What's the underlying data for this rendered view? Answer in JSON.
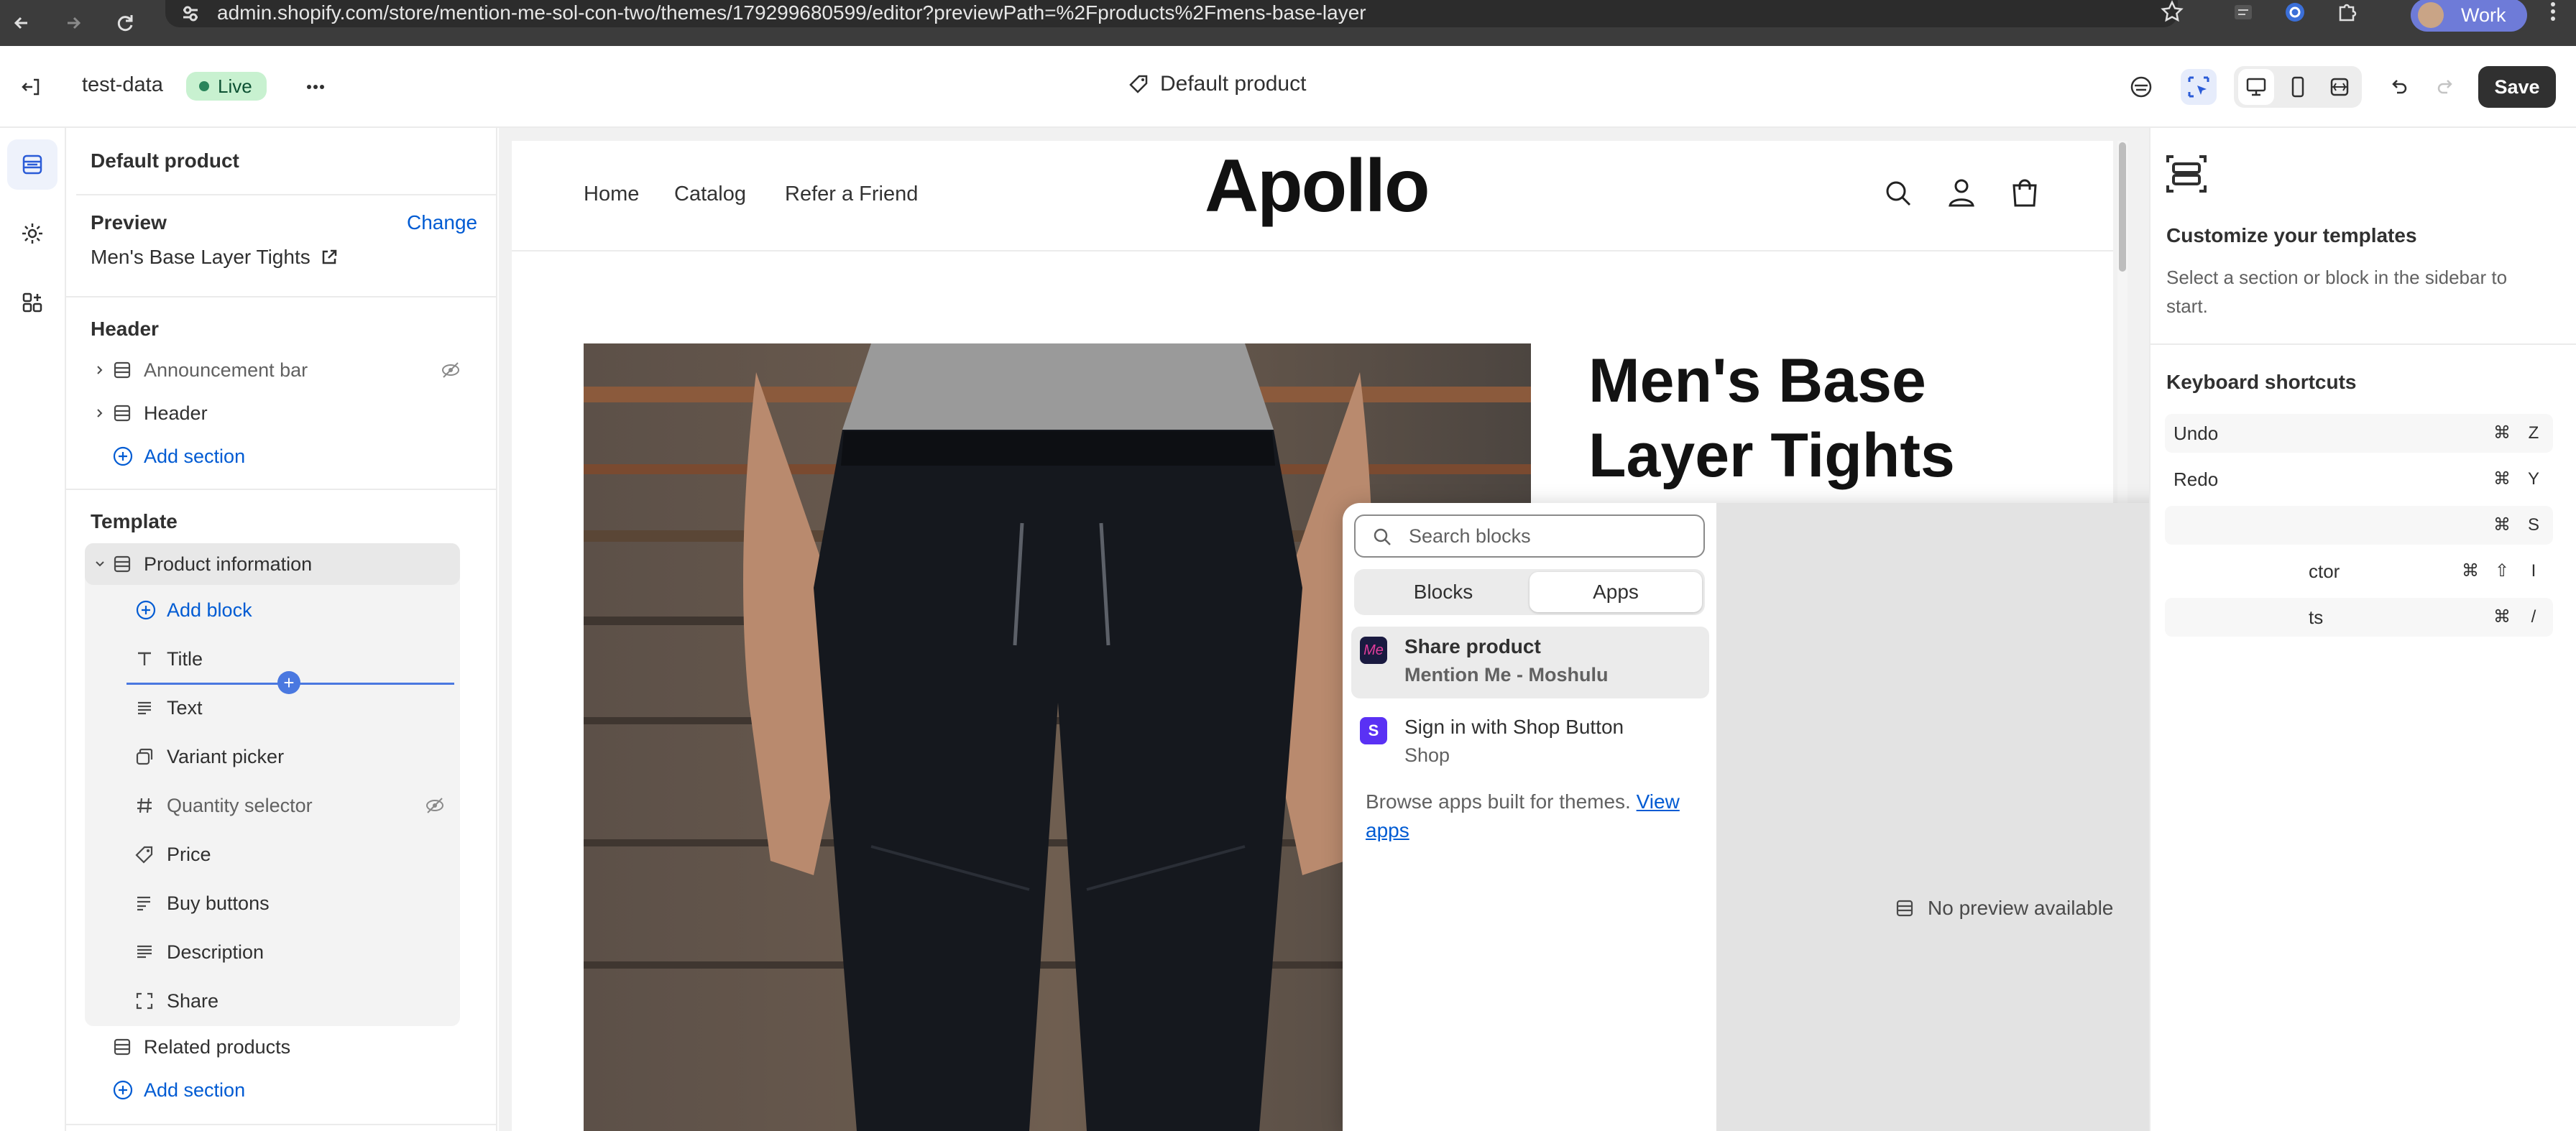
{
  "browser": {
    "url": "admin.shopify.com/store/mention-me-sol-con-two/themes/179299680599/editor?previewPath=%2Fproducts%2Fmens-base-layer",
    "profile_label": "Work"
  },
  "topbar": {
    "store_name": "test-data",
    "status_badge": "Live",
    "template_title": "Default product",
    "save_label": "Save"
  },
  "sidebar": {
    "title": "Default product",
    "preview_label": "Preview",
    "change_label": "Change",
    "preview_product": "Men's Base Layer Tights",
    "header_group": {
      "heading": "Header",
      "items": [
        {
          "label": "Announcement bar",
          "hidden": true
        },
        {
          "label": "Header",
          "hidden": false
        }
      ],
      "add_section": "Add section"
    },
    "template_group": {
      "heading": "Template",
      "section": "Product information",
      "add_block": "Add block",
      "blocks": [
        {
          "label": "Title",
          "icon": "title-icon"
        },
        {
          "label": "Text",
          "icon": "text-icon"
        },
        {
          "label": "Variant picker",
          "icon": "variant-picker-icon"
        },
        {
          "label": "Quantity selector",
          "icon": "quantity-icon",
          "hidden": true
        },
        {
          "label": "Price",
          "icon": "price-tag-icon"
        },
        {
          "label": "Buy buttons",
          "icon": "buy-buttons-icon"
        },
        {
          "label": "Description",
          "icon": "description-icon"
        },
        {
          "label": "Share",
          "icon": "share-icon"
        }
      ],
      "related": "Related products",
      "add_section": "Add section"
    }
  },
  "store": {
    "nav": [
      "Home",
      "Catalog",
      "Refer a Friend"
    ],
    "logo": "Apollo",
    "product_title": "Men's Base Layer Tights"
  },
  "popover": {
    "search_placeholder": "Search blocks",
    "tabs": [
      "Blocks",
      "Apps"
    ],
    "active_tab": "Apps",
    "apps": [
      {
        "name": "Share product",
        "provider": "Mention Me - Moshulu",
        "icon_text": "Me"
      },
      {
        "name": "Sign in with Shop Button",
        "provider": "Shop",
        "icon_text": "S"
      }
    ],
    "browse_text": "Browse apps built for themes.",
    "browse_link": "View apps",
    "no_preview": "No preview available"
  },
  "right_panel": {
    "heading": "Customize your templates",
    "description": "Select a section or block in the sidebar to start.",
    "shortcuts_heading": "Keyboard shortcuts",
    "shortcuts": [
      {
        "label": "Undo",
        "keys": [
          "⌘",
          "Z"
        ]
      },
      {
        "label": "Redo",
        "keys": [
          "⌘",
          "Y"
        ]
      },
      {
        "label": "",
        "keys": [
          "⌘",
          "S"
        ]
      },
      {
        "label": "ctor",
        "keys": [
          "⌘",
          "⇧",
          "I"
        ]
      },
      {
        "label": "ts",
        "keys": [
          "⌘",
          "/"
        ]
      }
    ]
  },
  "colors": {
    "accent": "#005bd3",
    "live_badge_bg": "#c8f1d0",
    "insert_line": "#4a78e0",
    "save_bg": "#303030"
  }
}
